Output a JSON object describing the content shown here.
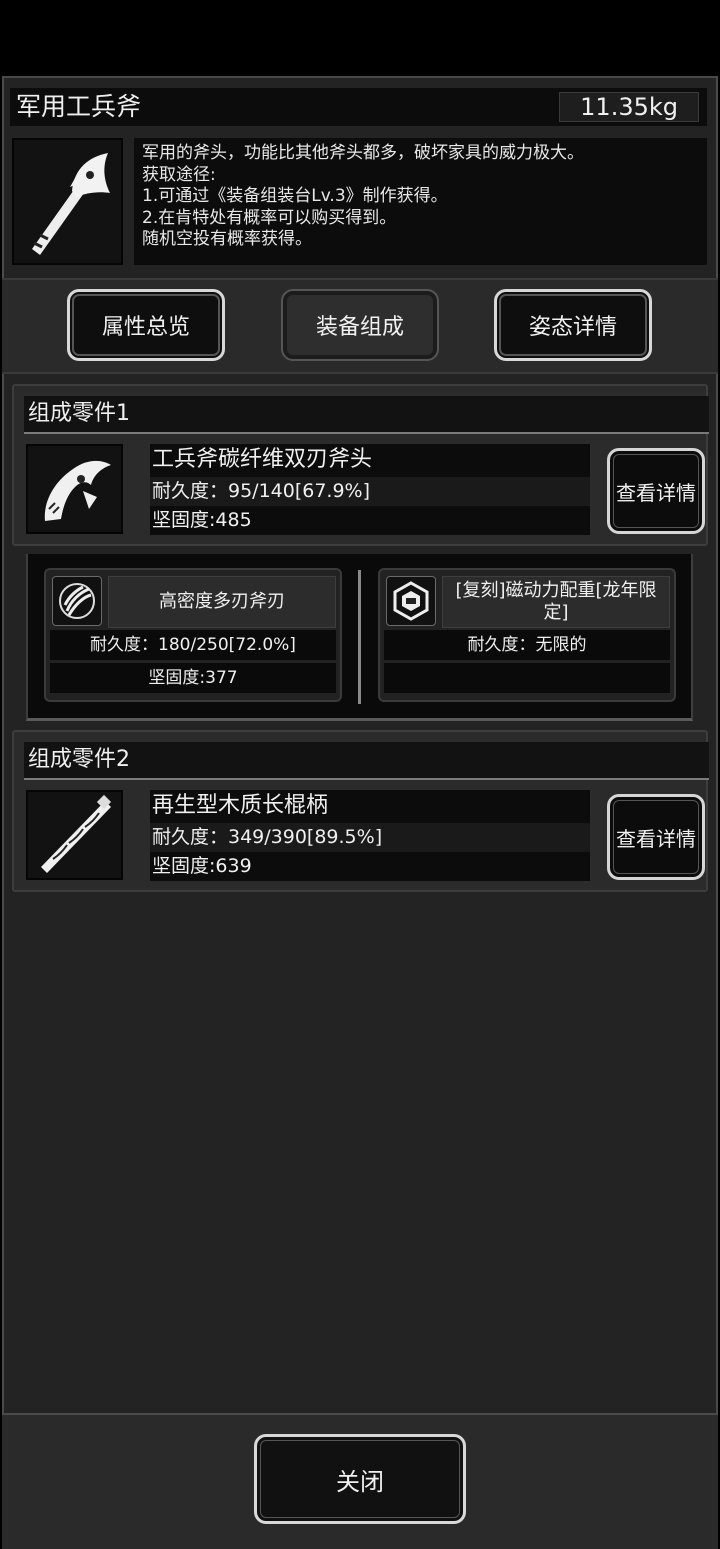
{
  "item": {
    "name": "军用工兵斧",
    "weight": "11.35kg",
    "description": [
      "军用的斧头，功能比其他斧头都多，破坏家具的威力极大。",
      "获取途径:",
      "1.可通过《装备组装台Lv.3》制作获得。",
      "2.在肯特处有概率可以购买得到。",
      "随机空投有概率获得。"
    ]
  },
  "tabs": [
    {
      "label": "属性总览",
      "state": "normal"
    },
    {
      "label": "装备组成",
      "state": "selected"
    },
    {
      "label": "姿态详情",
      "state": "normal"
    }
  ],
  "parts": [
    {
      "section_title": "组成零件1",
      "name": "工兵斧碳纤维双刃斧头",
      "durability": "耐久度：95/140[67.9%]",
      "hardness": "坚固度:485",
      "detail_label": "查看详情"
    },
    {
      "section_title": "组成零件2",
      "name": "再生型木质长棍柄",
      "durability": "耐久度：349/390[89.5%]",
      "hardness": "坚固度:639",
      "detail_label": "查看详情"
    }
  ],
  "subcomponents": [
    {
      "name": "高密度多刃斧刃",
      "durability": "耐久度：180/250[72.0%]",
      "hardness": "坚固度:377",
      "icon": "claw-blade-icon"
    },
    {
      "name": "[复刻]磁动力配重[龙年限定]",
      "durability": "耐久度：无限的",
      "hardness": "",
      "icon": "hex-weight-icon"
    }
  ],
  "close_label": "关闭"
}
